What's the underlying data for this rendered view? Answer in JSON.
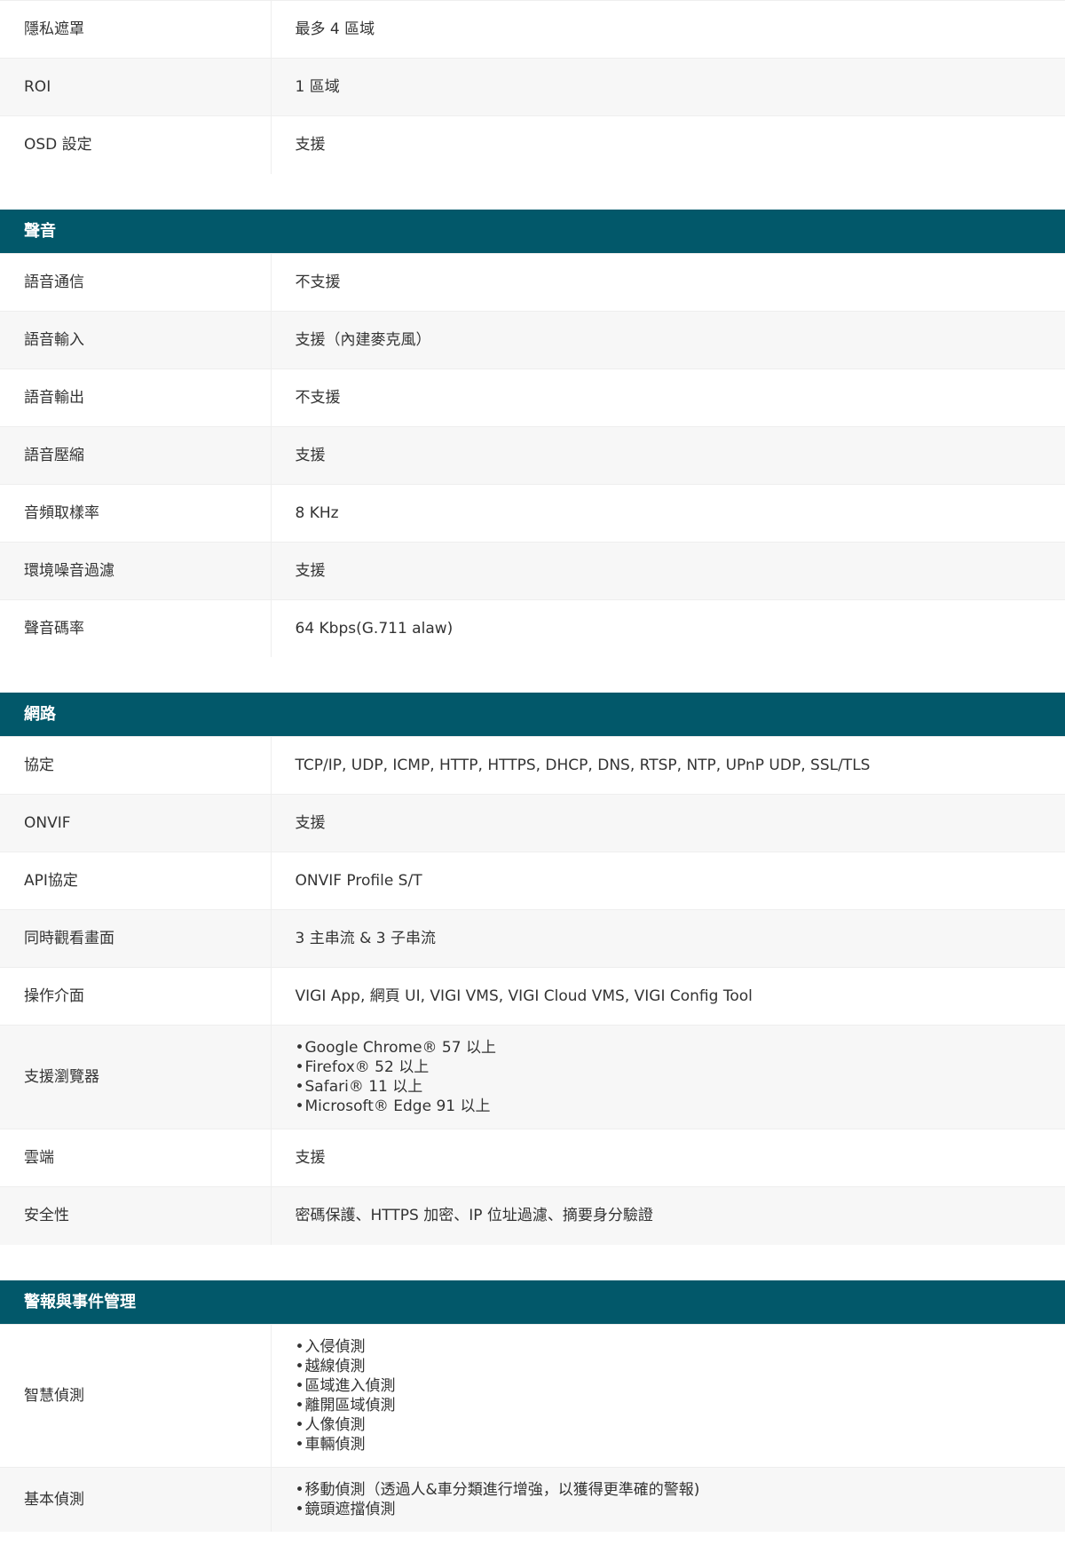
{
  "sections": [
    {
      "title": "",
      "rows": [
        {
          "label": "隱私遮罩",
          "value": "最多 4 區域"
        },
        {
          "label": "ROI",
          "value": "1 區域"
        },
        {
          "label": "OSD 設定",
          "value": "支援"
        }
      ]
    },
    {
      "title": "聲音",
      "rows": [
        {
          "label": "語音通信",
          "value": "不支援"
        },
        {
          "label": "語音輸入",
          "value": "支援（內建麥克風）"
        },
        {
          "label": "語音輸出",
          "value": "不支援"
        },
        {
          "label": "語音壓縮",
          "value": "支援"
        },
        {
          "label": "音頻取樣率",
          "value": "8 KHz"
        },
        {
          "label": "環境噪音過濾",
          "value": "支援"
        },
        {
          "label": "聲音碼率",
          "value": "64 Kbps(G.711 alaw)"
        }
      ]
    },
    {
      "title": "網路",
      "rows": [
        {
          "label": "協定",
          "value": "TCP/IP, UDP, ICMP, HTTP, HTTPS, DHCP, DNS, RTSP, NTP, UPnP UDP, SSL/TLS"
        },
        {
          "label": "ONVIF",
          "value": "支援"
        },
        {
          "label": "API協定",
          "value": "ONVIF Profile S/T"
        },
        {
          "label": "同時觀看畫面",
          "value": "3 主串流 & 3 子串流"
        },
        {
          "label": "操作介面",
          "value": "VIGI App, 網頁 UI, VIGI VMS, VIGI Cloud VMS, VIGI Config Tool"
        },
        {
          "label": "支援瀏覽器",
          "items": [
            "Google Chrome® 57 以上",
            "Firefox® 52 以上",
            "Safari® 11 以上",
            "Microsoft® Edge 91 以上"
          ]
        },
        {
          "label": "雲端",
          "value": "支援"
        },
        {
          "label": "安全性",
          "value": "密碼保護、HTTPS 加密、IP 位址過濾、摘要身分驗證"
        }
      ]
    },
    {
      "title": "警報與事件管理",
      "rows": [
        {
          "label": "智慧偵測",
          "items": [
            "入侵偵測",
            "越線偵測",
            "區域進入偵測",
            "離開區域偵測",
            "人像偵測",
            "車輛偵測"
          ]
        },
        {
          "label": "基本偵測",
          "items": [
            "移動偵測（透過人&車分類進行增強，以獲得更準確的警報)",
            "鏡頭遮擋偵測"
          ]
        }
      ]
    }
  ]
}
